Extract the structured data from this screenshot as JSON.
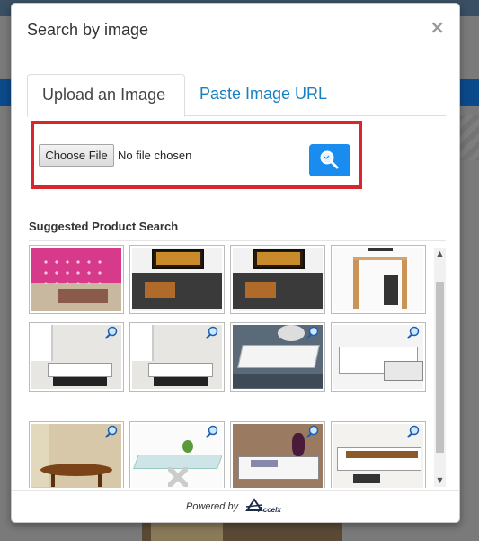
{
  "modal": {
    "title": "Search by image",
    "close_label": "×"
  },
  "tabs": [
    {
      "label": "Upload an Image",
      "active": true
    },
    {
      "label": "Paste Image URL",
      "active": false
    }
  ],
  "upload": {
    "choose_file_label": "Choose File",
    "status_text": "No file chosen",
    "search_icon": "search-image-icon"
  },
  "suggested": {
    "title": "Suggested Product Search",
    "thumbnails": [
      {
        "kind": "bed-room",
        "magnify_icon": false
      },
      {
        "kind": "tv-stand",
        "magnify_icon": false
      },
      {
        "kind": "tv-stand",
        "magnify_icon": false
      },
      {
        "kind": "computer-desk",
        "magnify_icon": false
      },
      {
        "kind": "white-coffee-table-living-room",
        "magnify_icon": true
      },
      {
        "kind": "white-coffee-table-living-room",
        "magnify_icon": true
      },
      {
        "kind": "white-coffee-table-rug",
        "magnify_icon": true
      },
      {
        "kind": "white-drawer-coffee-table",
        "magnify_icon": true
      },
      {
        "kind": "oval-wood-coffee-table",
        "magnify_icon": true
      },
      {
        "kind": "glass-coffee-table",
        "magnify_icon": true
      },
      {
        "kind": "white-coffee-table-vase",
        "magnify_icon": true
      },
      {
        "kind": "white-tv-cabinet",
        "magnify_icon": true
      }
    ]
  },
  "footer": {
    "powered_by": "Powered by",
    "logo_text": "Accelx"
  },
  "colors": {
    "accent": "#1a8cf0",
    "link": "#1a7fc1",
    "highlight_border": "#d9262e"
  }
}
